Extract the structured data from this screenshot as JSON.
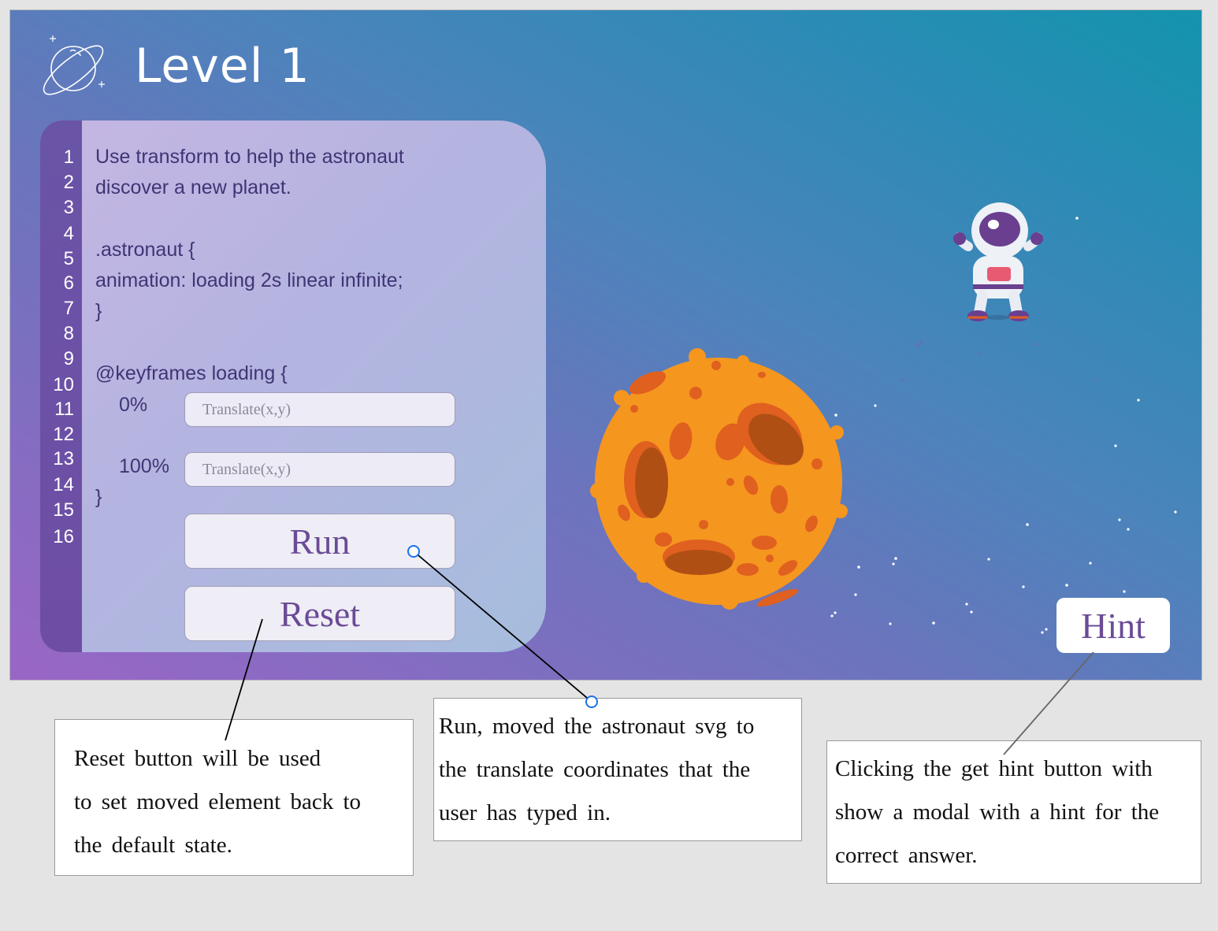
{
  "level": {
    "title": "Level 1",
    "logo_icon": "planet-ring-icon"
  },
  "editor": {
    "line_numbers": [
      "1",
      "2",
      "3",
      "4",
      "5",
      "6",
      "7",
      "8",
      "9",
      "10",
      "11",
      "12",
      "13",
      "14",
      "15",
      "16"
    ],
    "instructions_line1": "Use transform to help the astronaut",
    "instructions_line2": "discover a new planet.",
    "selector_open": ".astronaut {",
    "animation_rule": "animation: loading 2s linear infinite;",
    "selector_close": "}",
    "keyframes_open": "@keyframes loading {",
    "keyframe_start_label": "0%",
    "keyframe_start_placeholder": "Translate(x,y)",
    "keyframe_end_label": "100%",
    "keyframe_end_placeholder": "Translate(x,y)",
    "keyframes_close": "}"
  },
  "buttons": {
    "run": "Run",
    "reset": "Reset",
    "hint": "Hint"
  },
  "scene": {
    "planet_icon": "orange-cratered-planet-icon",
    "astronaut_icon": "astronaut-icon"
  },
  "annotations": {
    "reset": [
      "Reset button will be used",
      "to set moved element back to",
      "the default state."
    ],
    "run": [
      "Run, moved the astronaut svg to",
      "the translate coordinates that the",
      "user has typed in."
    ],
    "hint": [
      "Clicking the get hint button with",
      "show a modal with a hint for the",
      "correct answer."
    ]
  },
  "colors": {
    "gradient_start": "#9a66c6",
    "gradient_end": "#1394ad",
    "gutter": "#6a54a6",
    "code_text": "#3f3575",
    "button_text": "#6b4b96",
    "planet": "#f5961f",
    "crater": "#e0601f",
    "callout_line": "#000000",
    "callout_marker": "#1a73e8"
  }
}
